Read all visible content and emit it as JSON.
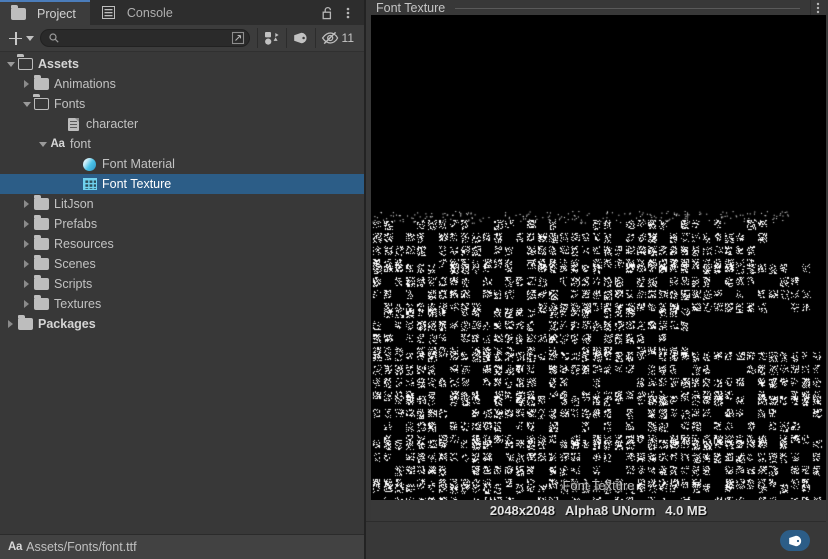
{
  "window": {
    "accent_blue": "#4b7dbb",
    "selection_blue": "#2c5d87",
    "panel_bg": "#383838"
  },
  "project_panel": {
    "tabs": [
      {
        "label": "Project",
        "icon": "folder-icon",
        "active": true
      },
      {
        "label": "Console",
        "icon": "console-list-icon",
        "active": false
      }
    ],
    "tab_actions": [
      {
        "name": "lock-icon",
        "label": "Lock"
      },
      {
        "name": "panel-menu-icon",
        "label": "Menu"
      }
    ],
    "toolbar": {
      "add_label": "+",
      "add_dropdown": "▾",
      "search": {
        "value": "",
        "placeholder": ""
      },
      "search_expand_icon": "expand-search-icon",
      "filter_by_type_icon": "filter-by-type-icon",
      "filter_by_label_icon": "filter-by-label-icon",
      "hidden_toggle_icon": "hidden-items-icon",
      "hidden_count": "11"
    },
    "tree": [
      {
        "label": "Assets",
        "depth": 0,
        "arrow": "down",
        "icon": "folder-open-icon",
        "bold": true,
        "selected": false
      },
      {
        "label": "Animations",
        "depth": 1,
        "arrow": "right",
        "icon": "folder-closed-icon",
        "bold": false,
        "selected": false
      },
      {
        "label": "Fonts",
        "depth": 1,
        "arrow": "down",
        "icon": "folder-open-icon",
        "bold": false,
        "selected": false
      },
      {
        "label": "character",
        "depth": 3,
        "arrow": "none",
        "icon": "document-icon",
        "bold": false,
        "selected": false
      },
      {
        "label": "font",
        "depth": 2,
        "arrow": "down",
        "icon": "font-aa-icon",
        "bold": false,
        "selected": false
      },
      {
        "label": "Font Material",
        "depth": 4,
        "arrow": "none",
        "icon": "material-sphere-icon",
        "bold": false,
        "selected": false
      },
      {
        "label": "Font Texture",
        "depth": 4,
        "arrow": "none",
        "icon": "texture-grid-icon",
        "bold": false,
        "selected": true
      },
      {
        "label": "LitJson",
        "depth": 1,
        "arrow": "right",
        "icon": "folder-closed-icon",
        "bold": false,
        "selected": false
      },
      {
        "label": "Prefabs",
        "depth": 1,
        "arrow": "right",
        "icon": "folder-closed-icon",
        "bold": false,
        "selected": false
      },
      {
        "label": "Resources",
        "depth": 1,
        "arrow": "right",
        "icon": "folder-closed-icon",
        "bold": false,
        "selected": false
      },
      {
        "label": "Scenes",
        "depth": 1,
        "arrow": "right",
        "icon": "folder-closed-icon",
        "bold": false,
        "selected": false
      },
      {
        "label": "Scripts",
        "depth": 1,
        "arrow": "right",
        "icon": "folder-closed-icon",
        "bold": false,
        "selected": false
      },
      {
        "label": "Textures",
        "depth": 1,
        "arrow": "right",
        "icon": "folder-closed-icon",
        "bold": false,
        "selected": false
      },
      {
        "label": "Packages",
        "depth": 0,
        "arrow": "right",
        "icon": "folder-closed-icon",
        "bold": true,
        "selected": false
      }
    ],
    "breadcrumb": {
      "icon": "font-aa-icon",
      "path": "Assets/Fonts/font.ttf"
    }
  },
  "inspector": {
    "title": "Font Texture",
    "menu_icon": "panel-menu-icon",
    "preview": {
      "watermark": "Font Texture",
      "dimensions": "2048x2048",
      "format": "Alpha8 UNorm",
      "size": "4.0 MB"
    },
    "footer": {
      "tag_button_icon": "asset-label-tag-icon"
    }
  }
}
